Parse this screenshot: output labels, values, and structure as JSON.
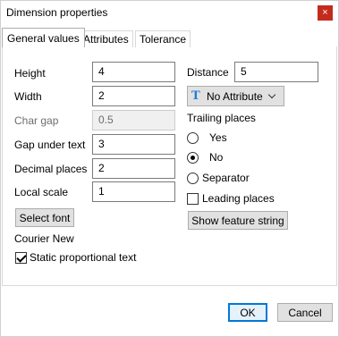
{
  "window": {
    "title": "Dimension properties",
    "close_label": "×"
  },
  "tabs": [
    {
      "label": "General values",
      "active": true
    },
    {
      "label": "Attributes",
      "active": false
    },
    {
      "label": "Tolerance",
      "active": false
    }
  ],
  "fields": {
    "height": {
      "label": "Height",
      "value": "4"
    },
    "width": {
      "label": "Width",
      "value": "2"
    },
    "char_gap": {
      "label": "Char gap",
      "value": "0.5",
      "disabled": true
    },
    "gap_under_text": {
      "label": "Gap under text",
      "value": "3"
    },
    "decimal_places": {
      "label": "Decimal places",
      "value": "2"
    },
    "local_scale": {
      "label": "Local scale",
      "value": "1"
    },
    "distance": {
      "label": "Distance",
      "value": "5"
    }
  },
  "attribute_dropdown": {
    "value": "No Attribute",
    "icon": "text-t-icon",
    "icon_glyph": "T"
  },
  "trailing_places": {
    "label": "Trailing places",
    "options": [
      {
        "label": "Yes",
        "checked": false
      },
      {
        "label": "No",
        "checked": true
      },
      {
        "label": "Separator",
        "checked": false
      }
    ]
  },
  "leading_places": {
    "label": "Leading places",
    "checked": false
  },
  "select_font_button": "Select font",
  "font_name": "Courier New",
  "static_proportional": {
    "label": "Static proportional text",
    "checked": true
  },
  "show_feature_string_button": "Show feature string",
  "ok_button": "OK",
  "cancel_button": "Cancel",
  "colors": {
    "close_bg": "#c42b1c",
    "accent": "#0078d7",
    "icon_blue": "#1f7fd6"
  }
}
